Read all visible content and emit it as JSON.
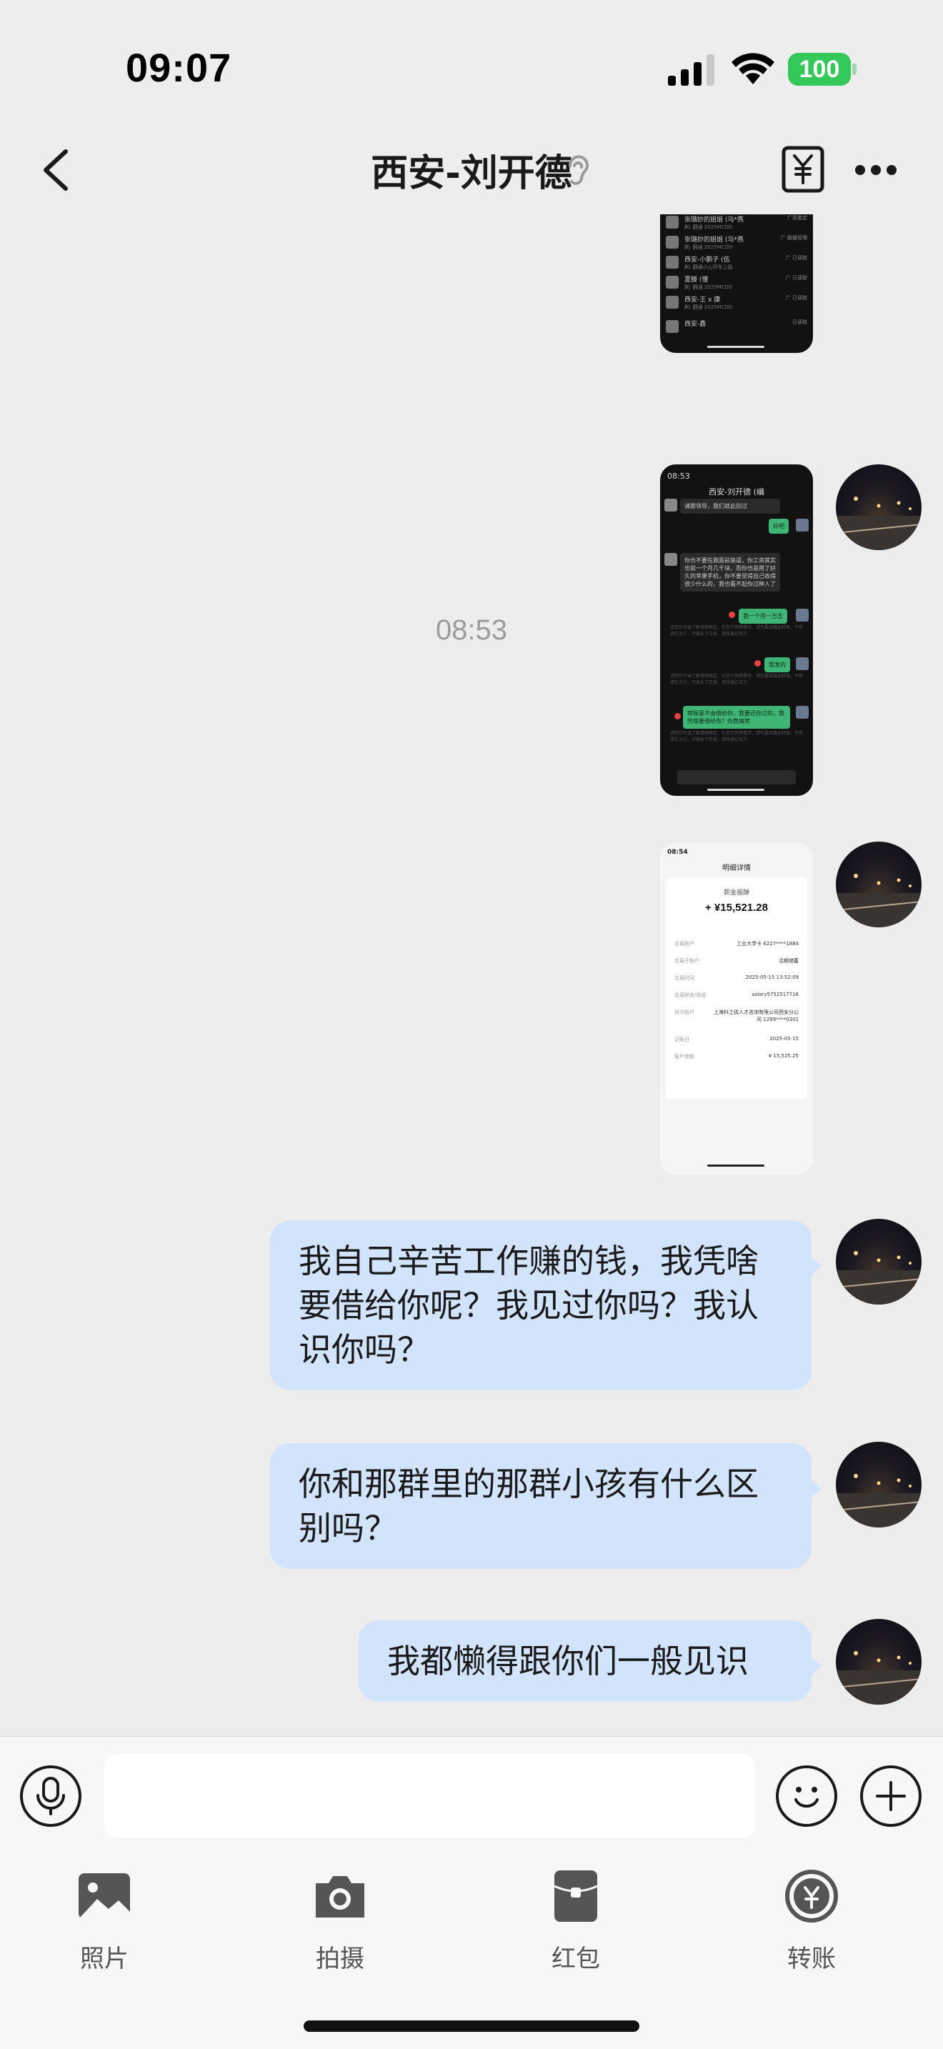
{
  "status": {
    "time": "09:07",
    "battery": "100"
  },
  "nav": {
    "title": "西安-刘开德"
  },
  "chat": {
    "timestamp": "08:53",
    "shot1": {
      "rows": [
        {
          "name": "张璐妙的姐姐 (马*燕",
          "sub": "刷: 翻通 2025MCDD",
          "tag": "广告鉴定"
        },
        {
          "name": "张璐妙的姐姐 (马*燕",
          "sub": "刷: 翻通 2025MCDD",
          "tag": "广 翻播管理"
        },
        {
          "name": "西安-小鹏子 (伍",
          "sub": "刷: 翻通小心开车上路",
          "tag": "广 已读取"
        },
        {
          "name": "夏滕 (慢",
          "sub": "刷: 翻通 2025MCDD",
          "tag": "广 已读取"
        },
        {
          "name": "西安-王 x 康",
          "sub": "刷: 翻通 2025MCDD",
          "tag": "广 已读取"
        },
        {
          "name": "西安-鑫",
          "sub": "",
          "tag": "已读取"
        }
      ]
    },
    "shot2": {
      "time": "08:53",
      "title": "西安-刘开德 (编",
      "m1": "请跟领导，我们就此别过",
      "m2": "好吧",
      "m3": "你也不要在我面前装逼，你工资其实也就一个月几千块，而你也是用了好久的苹果手机，你不要觉得自己收得很少什么的，我也看不起你过种人了",
      "m4": "我一个月一万五",
      "m5": "我发的",
      "m6": "转账是不会借给你，我要还你过的，我凭啥要借给你？你真搞笑",
      "note": "请您作为该了解清楚确定，在您不熟悉情况，请先要会搬此转账，不然请在对方，不能私下交易，请将通过官方"
    },
    "shot3": {
      "time": "08:54",
      "title": "明细详情",
      "type": "薪金报酬",
      "amount": "+ ¥15,521.28",
      "rows": [
        {
          "label": "交易账户",
          "value": "工业大学卡 6227****1884"
        },
        {
          "label": "交易子账户",
          "value": "活期储蓄"
        },
        {
          "label": "交易时间",
          "value": "2025-05-15 13:52:09"
        },
        {
          "label": "交易附言/用途",
          "value": "salary5752517716"
        },
        {
          "label": "对方账户",
          "value": "上海科之锐人才咨询有限公司西安分公司 1299****0301"
        },
        {
          "label": "记账日",
          "value": "2025-05-15"
        },
        {
          "label": "账户余额",
          "value": "¥ 15,525.25"
        }
      ]
    },
    "bubbles": {
      "b1": "我自己辛苦工作赚的钱，我凭啥要借给你呢？我见过你吗？我认识你吗？",
      "b2": "你和那群里的那群小孩有什么区别吗？",
      "b3": "我都懒得跟你们一般见识"
    }
  },
  "input": {
    "value": "",
    "placeholder": ""
  },
  "actions": [
    {
      "label": "照片",
      "icon": "photo-icon"
    },
    {
      "label": "拍摄",
      "icon": "camera-icon"
    },
    {
      "label": "红包",
      "icon": "red-packet-icon"
    },
    {
      "label": "转账",
      "icon": "transfer-icon"
    }
  ],
  "colors": {
    "bubble": "#d2e3fc",
    "background": "#ededed",
    "battery": "#34c759"
  }
}
